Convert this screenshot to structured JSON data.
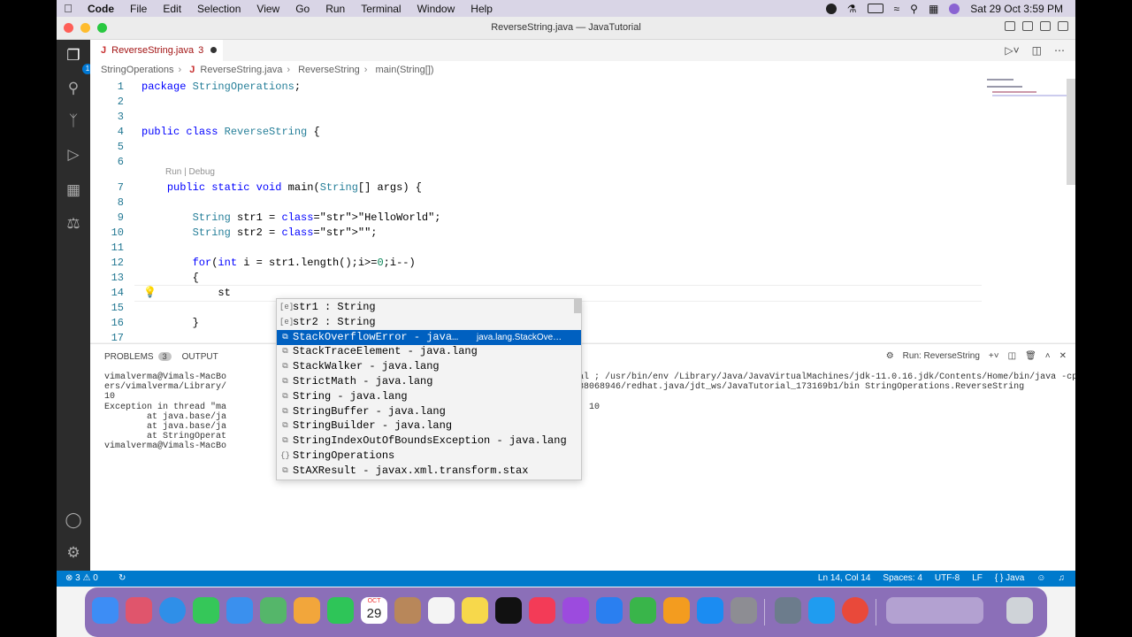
{
  "menubar": {
    "apple": "",
    "items": [
      "Code",
      "File",
      "Edit",
      "Selection",
      "View",
      "Go",
      "Run",
      "Terminal",
      "Window",
      "Help"
    ],
    "clock": "Sat 29 Oct  3:59 PM"
  },
  "window": {
    "title": "ReverseString.java — JavaTutorial"
  },
  "activity": {
    "explorer_badge": "1"
  },
  "tab": {
    "icon": "J",
    "name": "ReverseString.java",
    "problems": "3"
  },
  "breadcrumb": {
    "parts": [
      "StringOperations",
      "ReverseString.java",
      "ReverseString",
      "main(String[])"
    ]
  },
  "editor": {
    "codelens": "Run | Debug",
    "lines": [
      {
        "n": "1",
        "t": "package StringOperations;"
      },
      {
        "n": "2",
        "t": ""
      },
      {
        "n": "3",
        "t": ""
      },
      {
        "n": "4",
        "t": "public class ReverseString {"
      },
      {
        "n": "5",
        "t": ""
      },
      {
        "n": "6",
        "t": ""
      },
      {
        "n": "7",
        "t": "    public static void main(String[] args) {"
      },
      {
        "n": "8",
        "t": ""
      },
      {
        "n": "9",
        "t": "        String str1 = \"HelloWorld\";"
      },
      {
        "n": "10",
        "t": "        String str2 = \"\";"
      },
      {
        "n": "11",
        "t": ""
      },
      {
        "n": "12",
        "t": "        for(int i = str1.length();i>=0;i--)"
      },
      {
        "n": "13",
        "t": "        {"
      },
      {
        "n": "14",
        "t": "            st"
      },
      {
        "n": "15",
        "t": ""
      },
      {
        "n": "16",
        "t": "        }"
      },
      {
        "n": "17",
        "t": ""
      }
    ]
  },
  "suggestions": [
    {
      "icon": "[e]",
      "label": "str1 : String",
      "detail": ""
    },
    {
      "icon": "[e]",
      "label": "str2 : String",
      "detail": ""
    },
    {
      "icon": "⧉",
      "label": "StackOverflowError - java…",
      "detail": "java.lang.StackOve…"
    },
    {
      "icon": "⧉",
      "label": "StackTraceElement - java.lang",
      "detail": ""
    },
    {
      "icon": "⧉",
      "label": "StackWalker - java.lang",
      "detail": ""
    },
    {
      "icon": "⧉",
      "label": "StrictMath - java.lang",
      "detail": ""
    },
    {
      "icon": "⧉",
      "label": "String - java.lang",
      "detail": ""
    },
    {
      "icon": "⧉",
      "label": "StringBuffer - java.lang",
      "detail": ""
    },
    {
      "icon": "⧉",
      "label": "StringBuilder - java.lang",
      "detail": ""
    },
    {
      "icon": "⧉",
      "label": "StringIndexOutOfBoundsException - java.lang",
      "detail": ""
    },
    {
      "icon": "{}",
      "label": "StringOperations",
      "detail": ""
    },
    {
      "icon": "⧉",
      "label": "StAXResult - javax.xml.transform.stax",
      "detail": ""
    }
  ],
  "panel": {
    "tabs": [
      "PROBLEMS",
      "OUTPUT"
    ],
    "problems_count": "3",
    "run_label": "Run: ReverseString",
    "terminal_left": "vimalverma@Vimals-MacBo\ners/vimalverma/Library/\n10\nException in thread \"ma\n        at java.base/ja\n        at java.base/ja\n        at StringOperat\nvimalverma@Vimals-MacBo",
    "terminal_right": "JavaTutorial ; /usr/bin/env /Library/Java/JavaVirtualMachines/jdk-11.0.16.jdk/Contents/Home/bin/java -cp /Us\ned174e08b388068946/redhat.java/jdt_ws/JavaTutorial_173169b1/bin StringOperations.ReverseString\n\nt of range: 10"
  },
  "status": {
    "problems": "⊗ 3  ⚠ 0",
    "position": "Ln 14, Col 14",
    "spaces": "Spaces: 4",
    "encoding": "UTF-8",
    "eol": "LF",
    "language": "{ } Java"
  },
  "dock": {
    "calendar_month": "OCT",
    "calendar_day": "29"
  },
  "colors": {
    "accent": "#007acc",
    "selection": "#0060c0",
    "dock": "#8b6fb8"
  }
}
